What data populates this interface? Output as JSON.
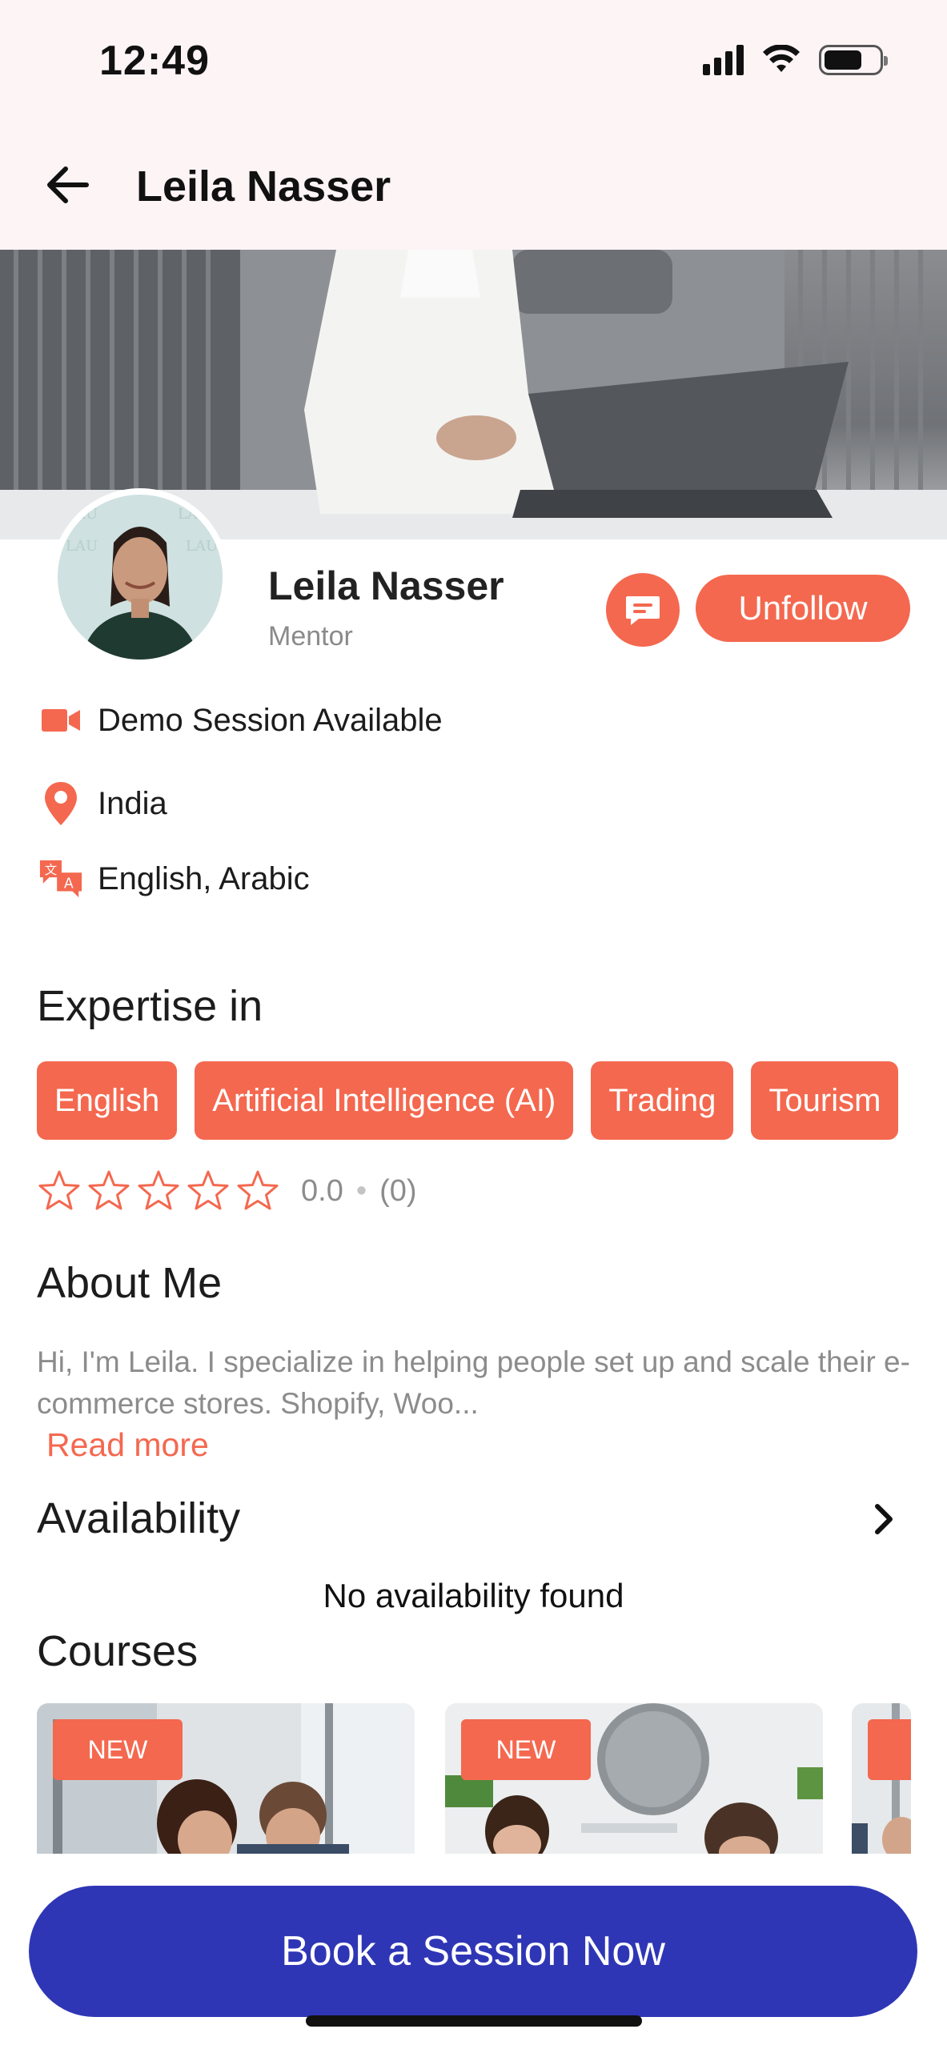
{
  "status_bar": {
    "time": "12:49"
  },
  "nav": {
    "title": "Leila Nasser"
  },
  "profile": {
    "name": "Leila Nasser",
    "role": "Mentor",
    "unfollow_label": "Unfollow"
  },
  "info": {
    "demo": "Demo Session Available",
    "location": "India",
    "languages": "English, Arabic"
  },
  "expertise": {
    "title": "Expertise in",
    "chips": [
      "English",
      "Artificial Intelligence (AI)",
      "Trading",
      "Tourism"
    ]
  },
  "rating": {
    "value": "0.0",
    "separator": "•",
    "count": "(0)",
    "stars_filled": 0,
    "stars_total": 5
  },
  "about": {
    "title": "About Me",
    "text": "Hi, I'm Leila. I specialize in helping people set up and scale their e-commerce stores. Shopify, Woo...",
    "read_more": "Read more"
  },
  "availability": {
    "title": "Availability",
    "empty": "No availability found"
  },
  "courses": {
    "title": "Courses",
    "badge": "NEW"
  },
  "cta": {
    "label": "Book a Session Now"
  },
  "colors": {
    "accent": "#f4684f",
    "primary": "#2f36b5",
    "header_bg": "#fdf4f6"
  }
}
